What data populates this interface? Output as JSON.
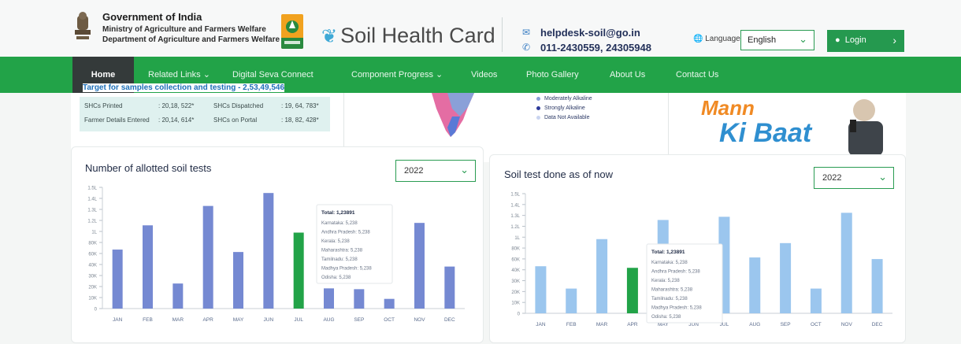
{
  "header": {
    "gov_title": "Government of India",
    "ministry": "Ministry of Agriculture and Farmers Welfare",
    "department": "Department of Agriculture and Farmers Welfare",
    "brand": "Soil Health Card",
    "email": "helpdesk-soil@go.in",
    "phone": "011-2430559, 24305948",
    "language_label": "Language",
    "language_value": "English",
    "login_label": "Login"
  },
  "nav": {
    "items": [
      "Home",
      "Related Links",
      "Digital Seva Connect",
      "Component Progress",
      "Videos",
      "Photo Gallery",
      "About Us",
      "Contact Us"
    ]
  },
  "summary": {
    "target_text": "Target for samples collection and testing - 2,53,49,546",
    "stats": [
      {
        "label": "SHCs Printed",
        "value": ": 20,18, 522*"
      },
      {
        "label": "SHCs Dispatched",
        "value": ": 19, 64, 783*"
      },
      {
        "label": "Farmer Details Entered",
        "value": ": 20,14, 614*"
      },
      {
        "label": "SHCs on Portal",
        "value": ": 18, 82, 428*"
      }
    ],
    "legend": [
      "Moderately Alkaline",
      "Strongly Alkaline",
      "Data Not Available"
    ],
    "legend_colors": [
      "#8aa0d8",
      "#2d3a9a",
      "#c9d4f0"
    ],
    "banner_text_1": "Mann",
    "banner_text_2": "Ki Baat"
  },
  "colors": {
    "brand_green": "#22a348",
    "nav_active": "#343a3a",
    "bar_blue_left": "#7589d2",
    "bar_blue_right": "#9bc6ee",
    "bar_highlight": "#22a348"
  },
  "chart_data": [
    {
      "type": "bar",
      "title": "Number of allotted soil tests",
      "year": "2022",
      "categories": [
        "JAN",
        "FEB",
        "MAR",
        "APR",
        "MAY",
        "JUN",
        "JUL",
        "AUG",
        "SEP",
        "OCT",
        "NOV",
        "DEC"
      ],
      "values": [
        73000,
        103000,
        31000,
        127000,
        70000,
        143000,
        94000,
        25000,
        24000,
        12000,
        106000,
        52000
      ],
      "highlight_index": 6,
      "yticks": [
        "0",
        "10K",
        "20K",
        "30K",
        "40K",
        "60K",
        "80K",
        "1L",
        "1.2L",
        "1.3L",
        "1.4L",
        "1.5L"
      ],
      "tooltip": {
        "title": "Total: 1,23891",
        "lines": [
          "Karnataka: 5,238",
          "Andhra Pradesh: 5,238",
          "Kerala: 5,238",
          "Maharashtra: 5,238",
          "Tamilnadu: 5,238",
          "Madhya Pradesh: 5,238",
          "Odisha: 5,238"
        ]
      }
    },
    {
      "type": "bar",
      "title": "Soil test done as of now",
      "year": "2022",
      "categories": [
        "JAN",
        "FEB",
        "MAR",
        "APR",
        "MAY",
        "JUN",
        "JUL",
        "AUG",
        "SEP",
        "OCT",
        "NOV",
        "DEC"
      ],
      "values": [
        59000,
        31000,
        93000,
        57000,
        117000,
        0,
        121000,
        70000,
        88000,
        31000,
        126000,
        68000
      ],
      "highlight_index": 3,
      "yticks": [
        "0",
        "10K",
        "20K",
        "30K",
        "40K",
        "60K",
        "80K",
        "1L",
        "1.2L",
        "1.3L",
        "1.4L",
        "1.5L"
      ],
      "tooltip": {
        "title": "Total: 1,23891",
        "lines": [
          "Karnataka: 5,238",
          "Andhra Pradesh: 5,238",
          "Kerala: 5,238",
          "Maharashtra: 5,238",
          "Tamilnadu: 5,238",
          "Madhya Pradesh: 5,238",
          "Odisha: 5,238"
        ]
      }
    }
  ]
}
